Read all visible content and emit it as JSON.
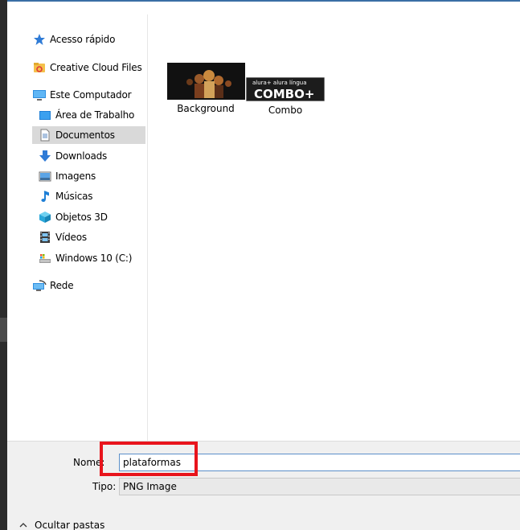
{
  "nav": {
    "quick_access": "Acesso rápido",
    "creative_cloud": "Creative Cloud Files",
    "this_pc": "Este Computador",
    "desktop": "Área de Trabalho",
    "documents": "Documentos",
    "downloads": "Downloads",
    "pictures": "Imagens",
    "music": "Músicas",
    "objects3d": "Objetos 3D",
    "videos": "Vídeos",
    "drive_c": "Windows 10 (C:)",
    "network": "Rede"
  },
  "files": [
    {
      "name": "Background"
    },
    {
      "name": "Combo",
      "thumb_text_top": "alura+ alura língua",
      "thumb_text_main": "COMBO+"
    }
  ],
  "form": {
    "name_label": "Nome:",
    "name_value": "plataformas",
    "type_label": "Tipo:",
    "type_value": "PNG Image"
  },
  "footer": {
    "hide_folders": "Ocultar pastas"
  },
  "colors": {
    "highlight": "#e8141c",
    "selected_bg": "#d9d9d9",
    "input_border": "#5b8fc9"
  }
}
